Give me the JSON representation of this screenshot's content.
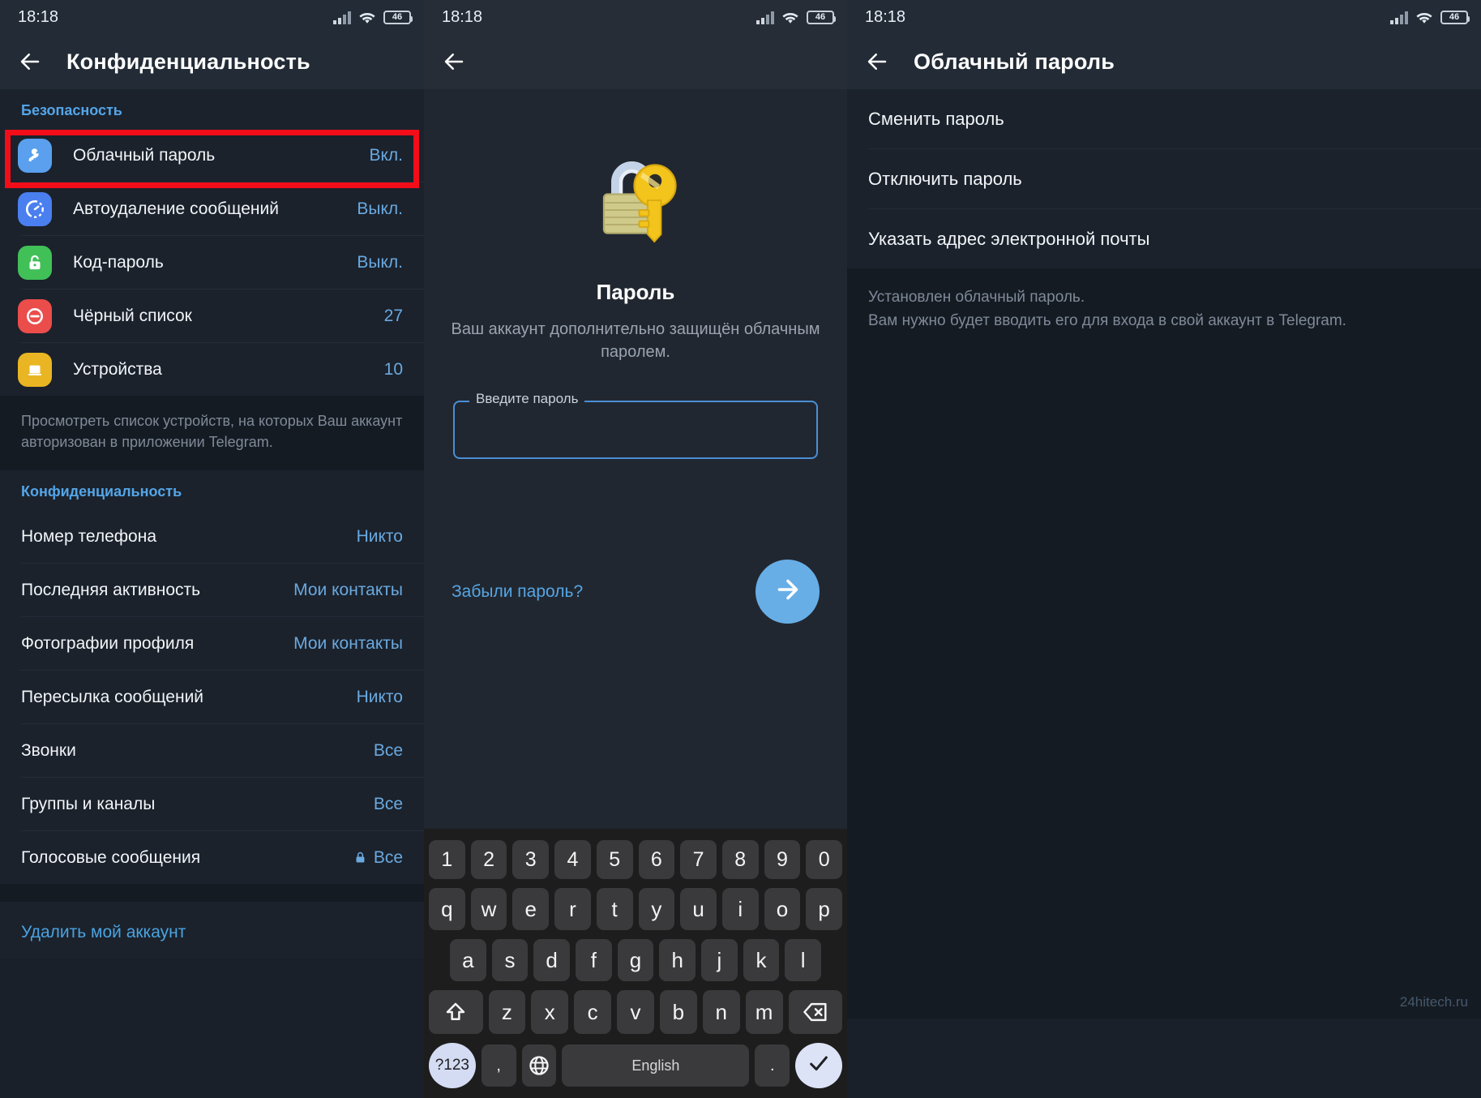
{
  "status_bar": {
    "time": "18:18",
    "battery": "46",
    "signal_icon": "signal-bars-icon",
    "wifi_icon": "wifi-icon",
    "battery_icon": "battery-icon"
  },
  "colors": {
    "accent": "#55a6e4",
    "highlight": "#f20d18",
    "panel_bg": "#1b222c",
    "header_bg": "#222b36",
    "key_bg": "#3a3a3c"
  },
  "panel1": {
    "title": "Конфиденциальность",
    "back_icon": "back-arrow-icon",
    "security_header": "Безопасность",
    "security_items": [
      {
        "label": "Облачный пароль",
        "value": "Вкл.",
        "icon": "key-icon"
      },
      {
        "label": "Автоудаление сообщений",
        "value": "Выкл.",
        "icon": "auto-delete-icon"
      },
      {
        "label": "Код-пароль",
        "value": "Выкл.",
        "icon": "padlock-icon"
      },
      {
        "label": "Чёрный список",
        "value": "27",
        "icon": "block-icon"
      },
      {
        "label": "Устройства",
        "value": "10",
        "icon": "laptop-icon"
      }
    ],
    "devices_hint": "Просмотреть список устройств, на которых Ваш аккаунт авторизован в приложении Telegram.",
    "privacy_header": "Конфиденциальность",
    "privacy_items": [
      {
        "label": "Номер телефона",
        "value": "Никто",
        "locked": false
      },
      {
        "label": "Последняя активность",
        "value": "Мои контакты",
        "locked": false
      },
      {
        "label": "Фотографии профиля",
        "value": "Мои контакты",
        "locked": false
      },
      {
        "label": "Пересылка сообщений",
        "value": "Никто",
        "locked": false
      },
      {
        "label": "Звонки",
        "value": "Все",
        "locked": false
      },
      {
        "label": "Группы и каналы",
        "value": "Все",
        "locked": false
      },
      {
        "label": "Голосовые сообщения",
        "value": "Все",
        "locked": true
      }
    ],
    "delete_account": "Удалить мой аккаунт"
  },
  "panel2": {
    "back_icon": "back-arrow-icon",
    "illustration_icon": "lock-and-key-icon",
    "title": "Пароль",
    "subtitle": "Ваш аккаунт дополнительно защищён облачным паролем.",
    "password_field": {
      "label": "Введите пароль",
      "value": "",
      "placeholder": ""
    },
    "forgot_link": "Забыли пароль?",
    "submit_icon": "arrow-right-icon",
    "keyboard": {
      "row1": [
        "1",
        "2",
        "3",
        "4",
        "5",
        "6",
        "7",
        "8",
        "9",
        "0"
      ],
      "row2": [
        "q",
        "w",
        "e",
        "r",
        "t",
        "y",
        "u",
        "i",
        "o",
        "p"
      ],
      "row3": [
        "a",
        "s",
        "d",
        "f",
        "g",
        "h",
        "j",
        "k",
        "l"
      ],
      "row4_shift": "shift-icon",
      "row4": [
        "z",
        "x",
        "c",
        "v",
        "b",
        "n",
        "m"
      ],
      "row4_backspace": "backspace-icon",
      "symbols_key": "?123",
      "comma_key": ",",
      "globe_key": "globe-icon",
      "space_key": "English",
      "period_key": ".",
      "enter_key": "checkmark-icon"
    }
  },
  "panel3": {
    "title": "Облачный пароль",
    "back_icon": "back-arrow-icon",
    "items": [
      {
        "label": "Сменить пароль"
      },
      {
        "label": "Отключить пароль"
      },
      {
        "label": "Указать адрес электронной почты"
      }
    ],
    "hint": "Установлен облачный пароль.\nВам нужно будет вводить его для входа в свой аккаунт в Telegram."
  },
  "watermark": "24hitech.ru"
}
